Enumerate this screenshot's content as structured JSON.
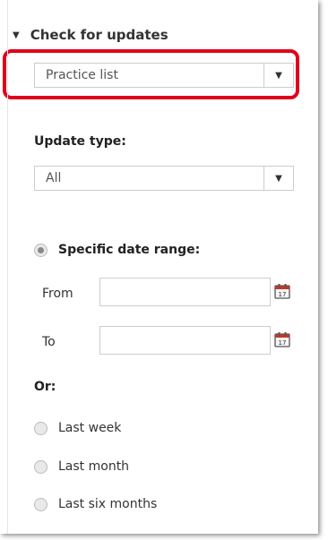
{
  "section": {
    "title": "Check for updates"
  },
  "list_select": {
    "value": "Practice list"
  },
  "update_type": {
    "label": "Update type:",
    "value": "All"
  },
  "date_range": {
    "label": "Specific date range:",
    "from_label": "From",
    "to_label": "To",
    "calendar_day": "17"
  },
  "or_label": "Or:",
  "presets": [
    "Last week",
    "Last month",
    "Last six months"
  ],
  "colors": {
    "highlight": "#e0001b",
    "border": "#cccccc"
  }
}
